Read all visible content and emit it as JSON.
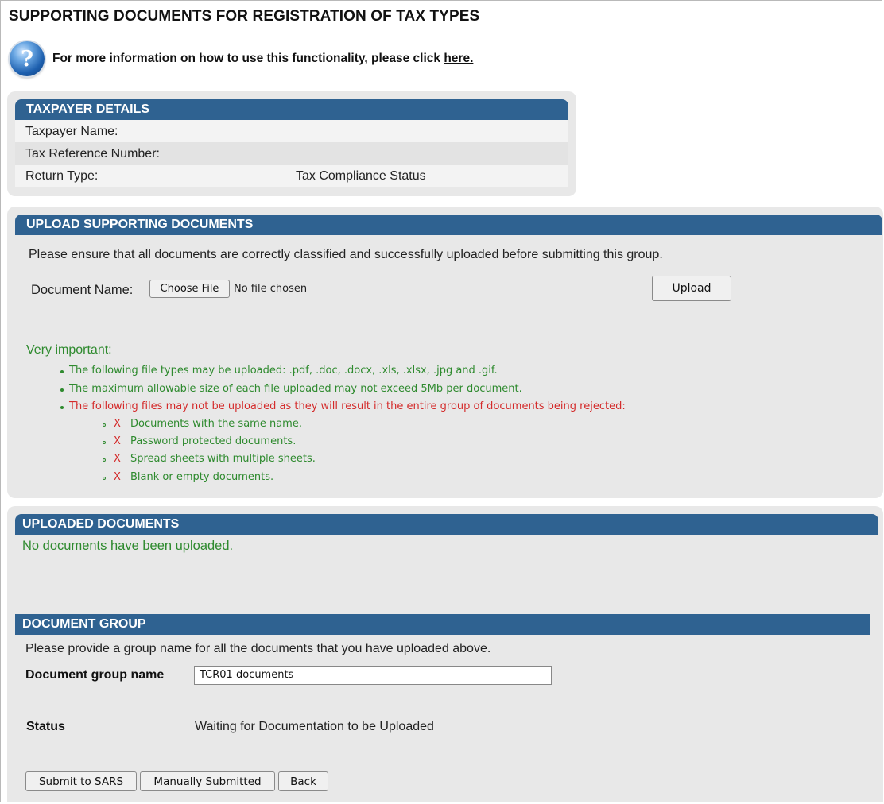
{
  "page": {
    "title": "SUPPORTING DOCUMENTS FOR REGISTRATION OF TAX TYPES",
    "help_text": "For more information on how to use this functionality, please click",
    "help_link": "here.",
    "help_icon_glyph": "?"
  },
  "taxpayer": {
    "header": "TAXPAYER DETAILS",
    "name_label": "Taxpayer Name:",
    "ref_label": "Tax Reference Number:",
    "return_label": "Return Type:",
    "return_value": "Tax Compliance Status"
  },
  "upload": {
    "header": "UPLOAD SUPPORTING DOCUMENTS",
    "instruction": "Please ensure that all documents are correctly classified and successfully uploaded before submitting this group.",
    "doc_name_label": "Document Name:",
    "choose_file": "Choose File",
    "no_file": "No file chosen",
    "upload_button": "Upload",
    "important_title": "Very important:",
    "file_types": "The following file types may be uploaded: .pdf, .doc, .docx, .xls, .xlsx, .jpg and .gif.",
    "max_size": "The maximum allowable size of each file uploaded may not exceed 5Mb per document.",
    "rejected_intro": "The following files may not be uploaded as they will result in the entire group of documents being rejected:",
    "reject_mark": "X",
    "rejected_items": [
      "Documents with the same name.",
      "Password protected documents.",
      "Spread sheets with multiple sheets.",
      "Blank or empty documents."
    ]
  },
  "uploaded": {
    "header": "UPLOADED DOCUMENTS",
    "empty_message": "No documents have been uploaded."
  },
  "group": {
    "header": "DOCUMENT GROUP",
    "instruction": "Please provide a group name for all the documents that you have uploaded above.",
    "name_label": "Document group name",
    "name_value": "TCR01 documents",
    "status_label": "Status",
    "status_value": "Waiting for Documentation to be Uploaded"
  },
  "actions": {
    "submit": "Submit to SARS",
    "manual": "Manually Submitted",
    "back": "Back"
  },
  "colors": {
    "header_blue": "#2f6291",
    "panel_gray": "#e8e8e8",
    "info_green": "#2e8a2e",
    "warn_red": "#d42a2a"
  }
}
